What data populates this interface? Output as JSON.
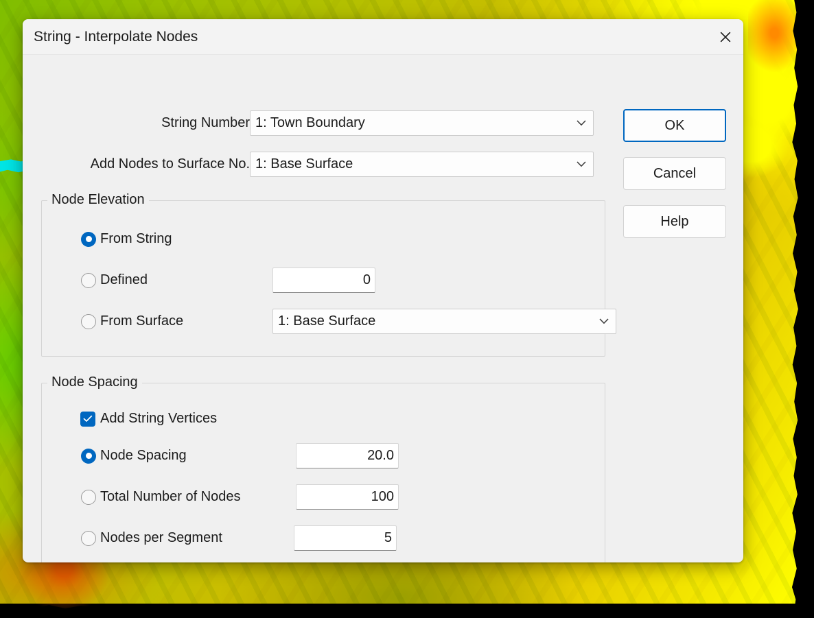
{
  "window": {
    "title": "String - Interpolate Nodes",
    "close_icon": "close-icon"
  },
  "form": {
    "string_number": {
      "label": "String Number",
      "value": "1: Town Boundary",
      "chevron_icon": "chevron-down-icon"
    },
    "add_nodes_to_surface": {
      "label": "Add Nodes to Surface No.",
      "value": "1: Base Surface",
      "chevron_icon": "chevron-down-icon"
    }
  },
  "node_elevation": {
    "title": "Node Elevation",
    "options": [
      {
        "label": "From String",
        "selected": true
      },
      {
        "label": "Defined",
        "selected": false
      },
      {
        "label": "From Surface",
        "selected": false
      }
    ],
    "defined_value": "0",
    "from_surface_value": "1: Base Surface"
  },
  "node_spacing": {
    "title": "Node Spacing",
    "add_string_vertices": {
      "label": "Add String Vertices",
      "checked": true,
      "check_icon": "checkmark-icon"
    },
    "options": [
      {
        "label": "Node Spacing",
        "selected": true,
        "value": "20.0"
      },
      {
        "label": "Total Number of Nodes",
        "selected": false,
        "value": "100"
      },
      {
        "label": "Nodes per Segment",
        "selected": false,
        "value": "5"
      }
    ]
  },
  "buttons": {
    "ok": "OK",
    "cancel": "Cancel",
    "help": "Help"
  },
  "colors": {
    "accent": "#0067c0",
    "dialog_bg": "#f0f0f0",
    "titlebar_bg": "#f3f3f3",
    "text": "#1b1b1b"
  }
}
